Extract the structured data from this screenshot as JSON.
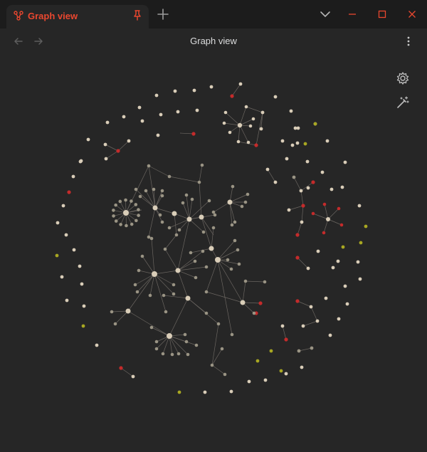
{
  "window": {
    "minimize_icon": "minimize-icon",
    "maximize_icon": "maximize-icon",
    "close_icon": "close-icon"
  },
  "tab": {
    "title": "Graph view",
    "icon": "graph-icon",
    "pin_icon": "pin-icon",
    "accent": "#e9472f"
  },
  "toolbar": {
    "title": "Graph view"
  },
  "colors": {
    "node": "#d9cdb8",
    "node_dim": "#9a9484",
    "attachment": "#c42b2b",
    "tag": "#a8a722",
    "edge": "#6a6560",
    "background": "#262626"
  }
}
